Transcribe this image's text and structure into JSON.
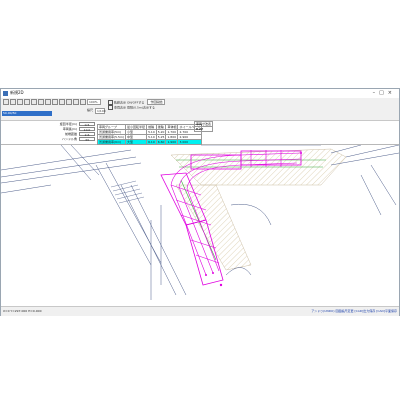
{
  "window": {
    "title": "新規2D"
  },
  "toolbar": {
    "name_field": "名称設定",
    "name_value": "50.00/50",
    "zoom_value": "100%",
    "scale_label": "縮尺",
    "scale_value": "1/100",
    "check_option_1": "軌跡表示 ON/OFFする",
    "check_option_2": "車両表示 間隔(0.5m)表示する",
    "right_button": "作図開始"
  },
  "params": {
    "labels": [
      "旋回半径(m)",
      "車両長(m)",
      "前端距離",
      "ハンドル角"
    ],
    "values": [
      "0.5",
      "10.0",
      "2.6",
      "33"
    ]
  },
  "grid": {
    "headers": [
      "車両グループ",
      "最小回転半径",
      "前輪",
      "後輪",
      "車体幅",
      "ホイールベース"
    ],
    "rows": [
      [
        "普通乗用車(5m)",
        "小型",
        "5.10",
        "5.20",
        "1.700",
        "2.700"
      ],
      [
        "普通乗用車(5.5m)",
        "中型",
        "5.10",
        "5.25",
        "1.800",
        "2.900"
      ],
      [
        "普通乗用車(6m)",
        "大型",
        "6.10",
        "6.60",
        "1.900",
        "3.000"
      ]
    ],
    "side_header": "車両寸法表",
    "side_value": "B.ZZ"
  },
  "status": {
    "coords": "X=0 Y=297.000 H=0.000",
    "right_text": "アンドゥ(UNDO)  図面縮尺変更  [CAD]出力保存  [CAD]平面保存"
  },
  "colors": {
    "vehicle_path": "#e000e0",
    "site_lines": "#4d5d8a",
    "hatch": "#d7c9a8",
    "guide_green": "#3caa3c",
    "highlight_row": "#00f0f0"
  }
}
